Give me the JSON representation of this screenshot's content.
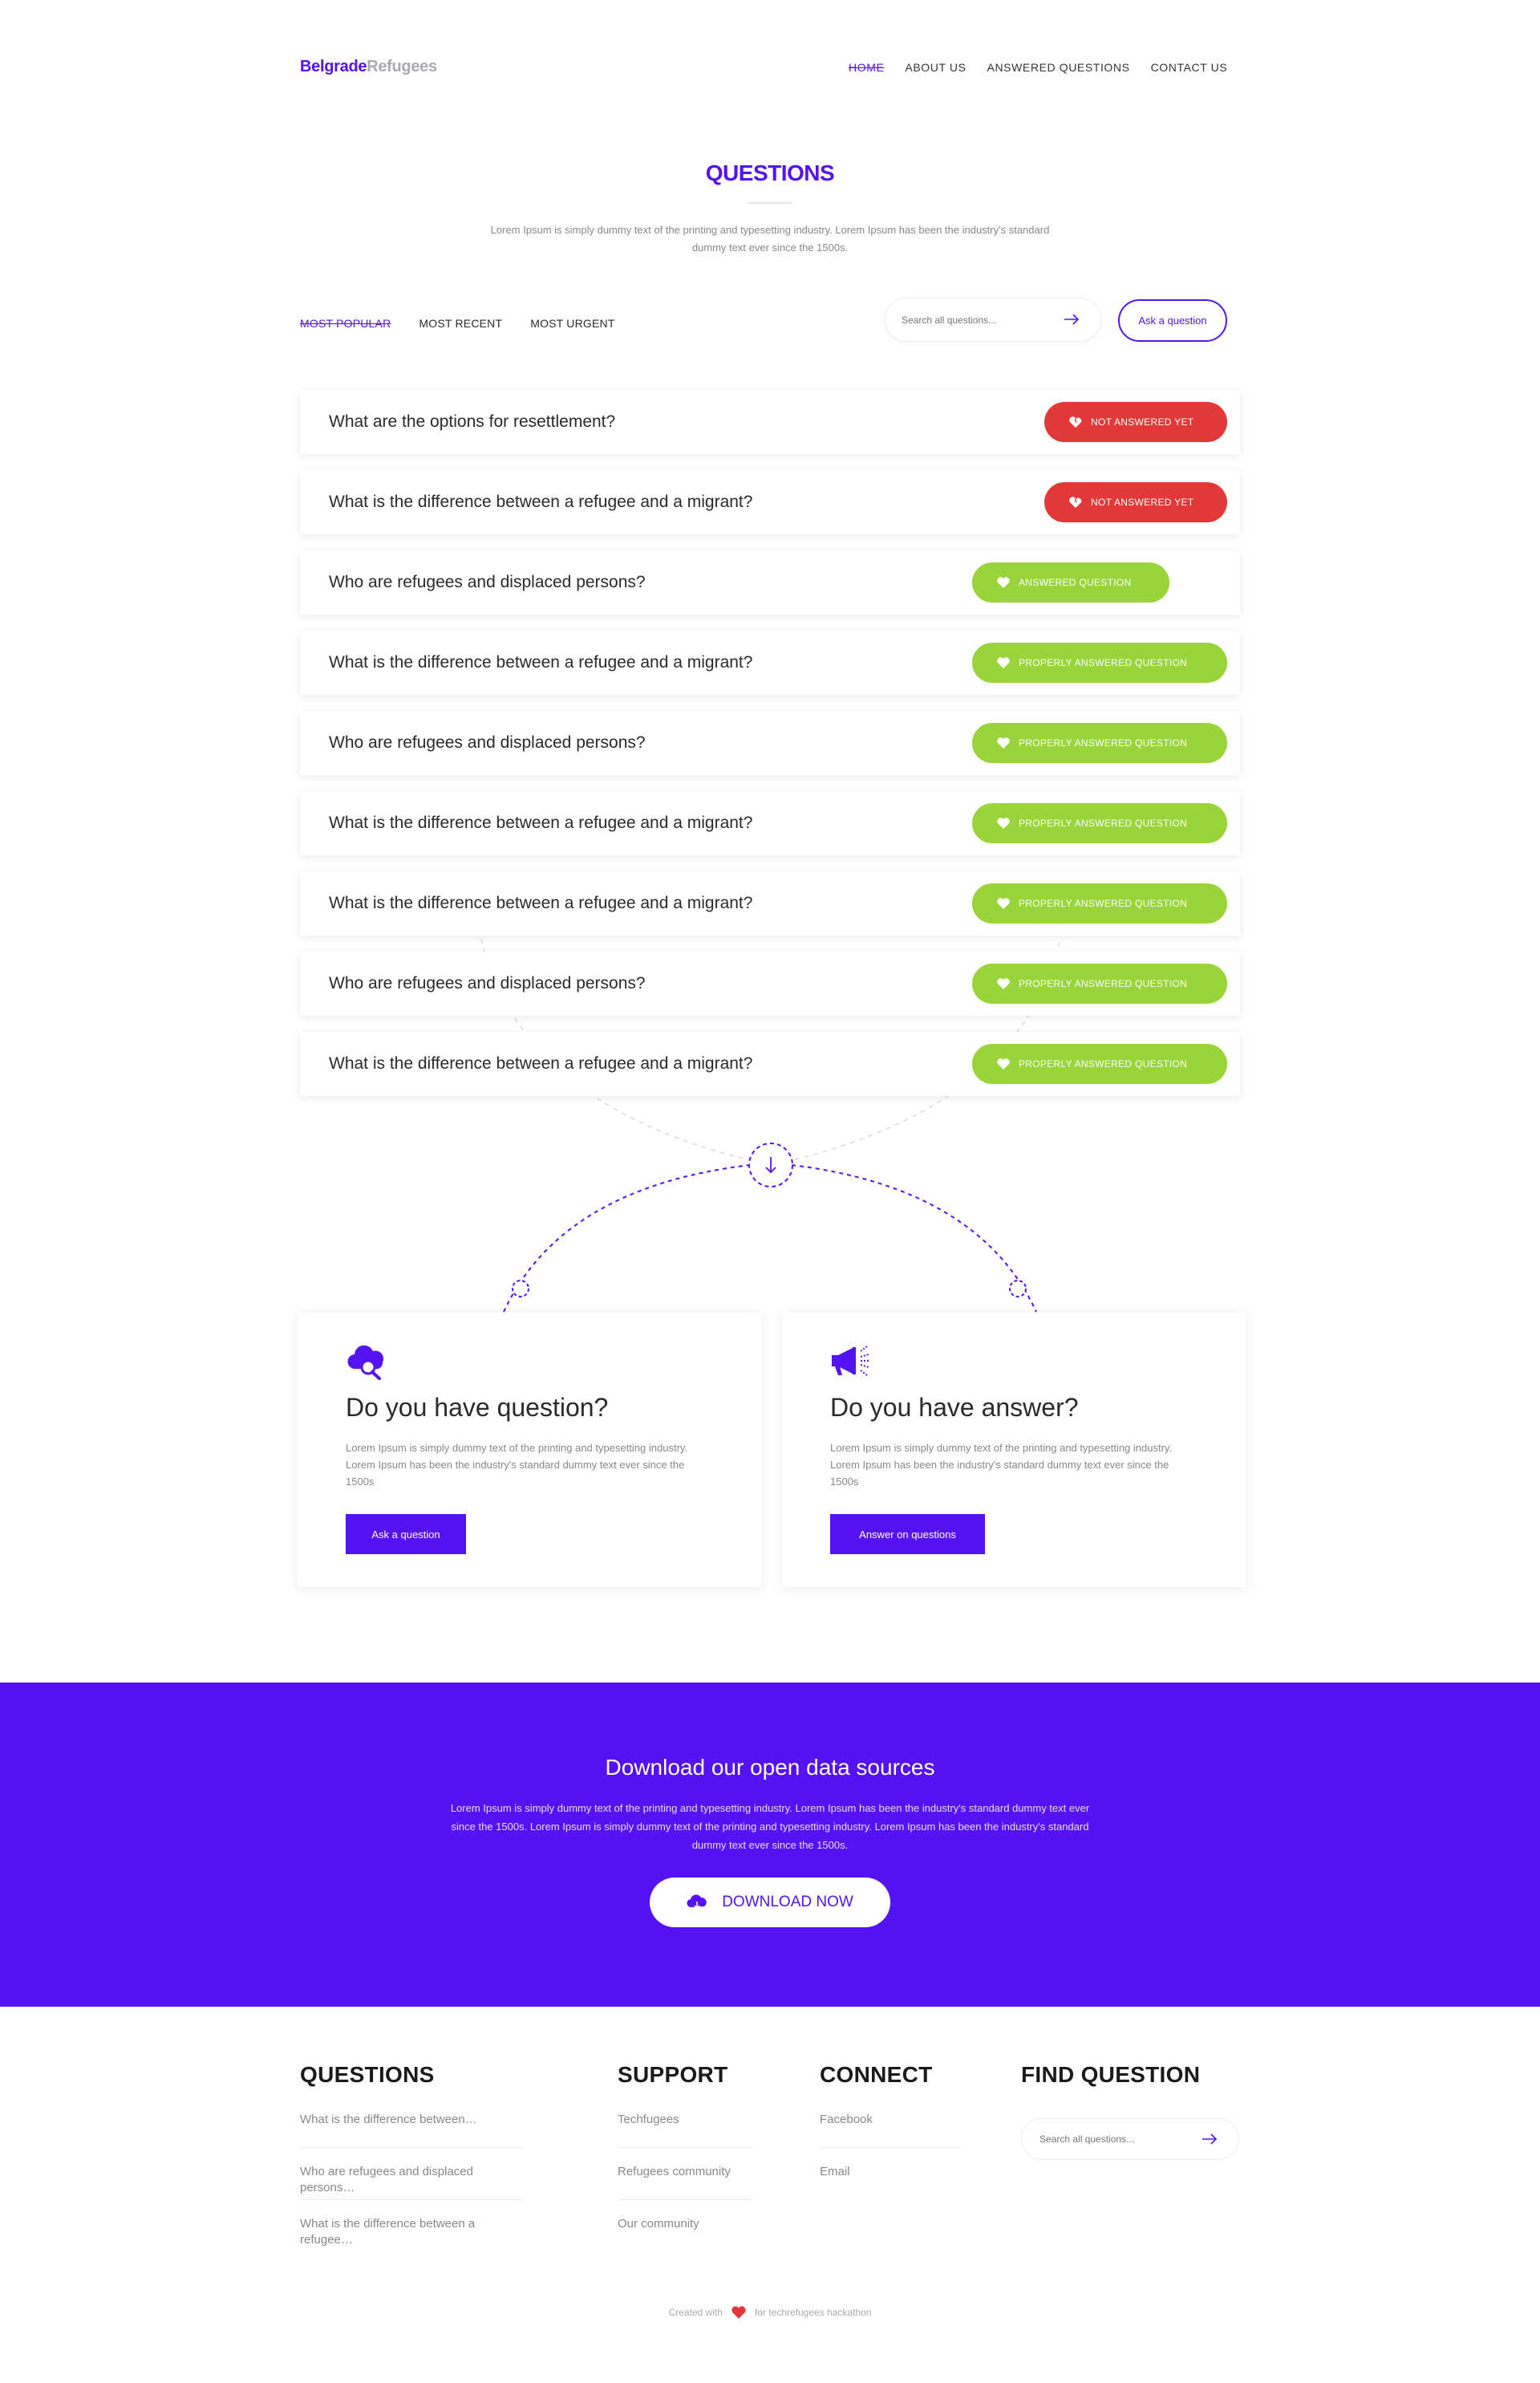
{
  "nav": {
    "logo_part1": "Belgrade",
    "logo_part2": "Refugees",
    "links": [
      "HOME",
      "ABOUT US",
      "ANSWERED QUESTIONS",
      "CONTACT US"
    ]
  },
  "header": {
    "title": "QUESTIONS",
    "subtitle": "Lorem Ipsum is simply dummy text of the printing and typesetting industry. Lorem Ipsum has been the industry's standard dummy text ever since the 1500s."
  },
  "filters": [
    "MOST POPULAR",
    "MOST RECENT",
    "MOST URGENT"
  ],
  "search": {
    "placeholder": "Search all questions..."
  },
  "ask_button": "Ask a question",
  "questions": [
    {
      "text": "What are the options for resettlement?",
      "status": "NOT ANSWERED YET"
    },
    {
      "text": "What is the difference between a refugee and a migrant?",
      "status": "NOT ANSWERED YET"
    },
    {
      "text": "Who are refugees and displaced persons?",
      "status": "ANSWERED QUESTION"
    },
    {
      "text": "What is the difference between a refugee and a migrant?",
      "status": "PROPERLY ANSWERED QUESTION"
    },
    {
      "text": "Who are refugees and displaced persons?",
      "status": "PROPERLY ANSWERED QUESTION"
    },
    {
      "text": "What is the difference between a refugee and a migrant?",
      "status": "PROPERLY ANSWERED QUESTION"
    },
    {
      "text": "What is the difference between a refugee and a migrant?",
      "status": "PROPERLY ANSWERED QUESTION"
    },
    {
      "text": "Who are refugees and displaced persons?",
      "status": "PROPERLY ANSWERED QUESTION"
    },
    {
      "text": "What is the difference between a refugee and a migrant?",
      "status": "PROPERLY ANSWERED QUESTION"
    }
  ],
  "cards": {
    "question": {
      "icon": "cloud-search-icon",
      "title": "Do you have question?",
      "text": "Lorem Ipsum is simply dummy text of the printing and typesetting industry. Lorem Ipsum has been the industry's standard dummy text ever since the 1500s",
      "button": "Ask a question"
    },
    "answer": {
      "icon": "megaphone-icon",
      "title": "Do you have answer?",
      "text": "Lorem Ipsum is simply dummy text of the printing and typesetting industry. Lorem Ipsum has been the industry's standard dummy text ever since the 1500s",
      "button": "Answer on questions"
    }
  },
  "banner": {
    "title": "Download our open data sources",
    "text": "Lorem Ipsum is simply dummy text of the printing and typesetting industry. Lorem Ipsum has been the industry's standard dummy text ever since the 1500s. Lorem Ipsum is simply dummy text of the printing and typesetting industry. Lorem Ipsum has been the industry's standard dummy text ever since the 1500s.",
    "button": "DOWNLOAD NOW"
  },
  "footer": {
    "questions": {
      "title": "QUESTIONS",
      "links": [
        "What is the difference between…",
        "Who are refugees and displaced persons…",
        "What is the difference between a refugee…"
      ]
    },
    "support": {
      "title": "SUPPORT",
      "links": [
        "Techfugees",
        "Refugees community",
        "Our community"
      ]
    },
    "connect": {
      "title": "CONNECT",
      "links": [
        "Facebook",
        "Email"
      ]
    },
    "find": {
      "title": "FIND QUESTION",
      "placeholder": "Search all questions..."
    },
    "credit_before": "Created with",
    "credit_after": "for techrefugees hackathon"
  },
  "colors": {
    "brand": "#5512f5",
    "danger": "#e23838",
    "success": "#9ad43b"
  }
}
